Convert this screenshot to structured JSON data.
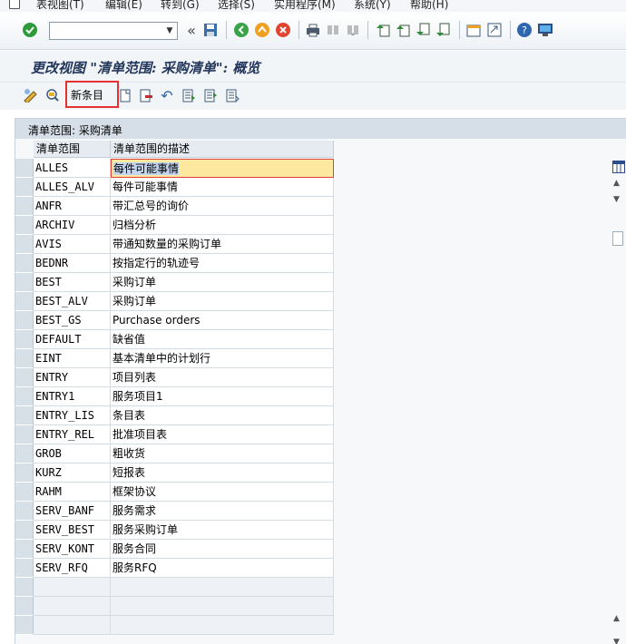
{
  "menu": {
    "items": [
      "表视图(T)",
      "编辑(E)",
      "转到(G)",
      "选择(S)",
      "实用程序(M)",
      "系统(Y)",
      "帮助(H)"
    ]
  },
  "toolbar": {
    "command_field_value": "",
    "icons": [
      "check-icon",
      "back-double-icon",
      "save-icon",
      "back-icon",
      "exit-icon",
      "cancel-icon",
      "print-icon",
      "find-icon",
      "find-next-icon",
      "first-page-icon",
      "prev-page-icon",
      "next-page-icon",
      "last-page-icon",
      "new-session-icon",
      "shortcut-icon",
      "help-icon",
      "customize-icon"
    ]
  },
  "page": {
    "title": "更改视图 \"清单范围: 采购清单\": 概览"
  },
  "app_toolbar": {
    "new_entries_label": "新条目",
    "icons": [
      "display-change-icon",
      "select-all-icon",
      "copy-icon",
      "delete-icon",
      "undo-icon",
      "select-block-icon",
      "deselect-icon",
      "details-icon"
    ]
  },
  "highlight_color": "#e53030",
  "table": {
    "panel_title": "清单范围: 采购清单",
    "columns": [
      "清单范围",
      "清单范围的描述"
    ],
    "rows": [
      [
        "ALLES",
        "每件可能事情"
      ],
      [
        "ALLES_ALV",
        "每件可能事情"
      ],
      [
        "ANFR",
        "带汇总号的询价"
      ],
      [
        "ARCHIV",
        "归档分析"
      ],
      [
        "AVIS",
        "带通知数量的采购订单"
      ],
      [
        "BEDNR",
        "按指定行的轨迹号"
      ],
      [
        "BEST",
        "采购订单"
      ],
      [
        "BEST_ALV",
        "采购订单"
      ],
      [
        "BEST_GS",
        "Purchase orders"
      ],
      [
        "DEFAULT",
        "缺省值"
      ],
      [
        "EINT",
        "基本清单中的计划行"
      ],
      [
        "ENTRY",
        "项目列表"
      ],
      [
        "ENTRY1",
        "服务项目1"
      ],
      [
        "ENTRY_LIS",
        "条目表"
      ],
      [
        "ENTRY_REL",
        "批准项目表"
      ],
      [
        "GROB",
        "粗收货"
      ],
      [
        "KURZ",
        "短报表"
      ],
      [
        "RAHM",
        "框架协议"
      ],
      [
        "SERV_BANF",
        "服务需求"
      ],
      [
        "SERV_BEST",
        "服务采购订单"
      ],
      [
        "SERV_KONT",
        "服务合同"
      ],
      [
        "SERV_RFQ",
        "服务RFQ"
      ]
    ]
  }
}
